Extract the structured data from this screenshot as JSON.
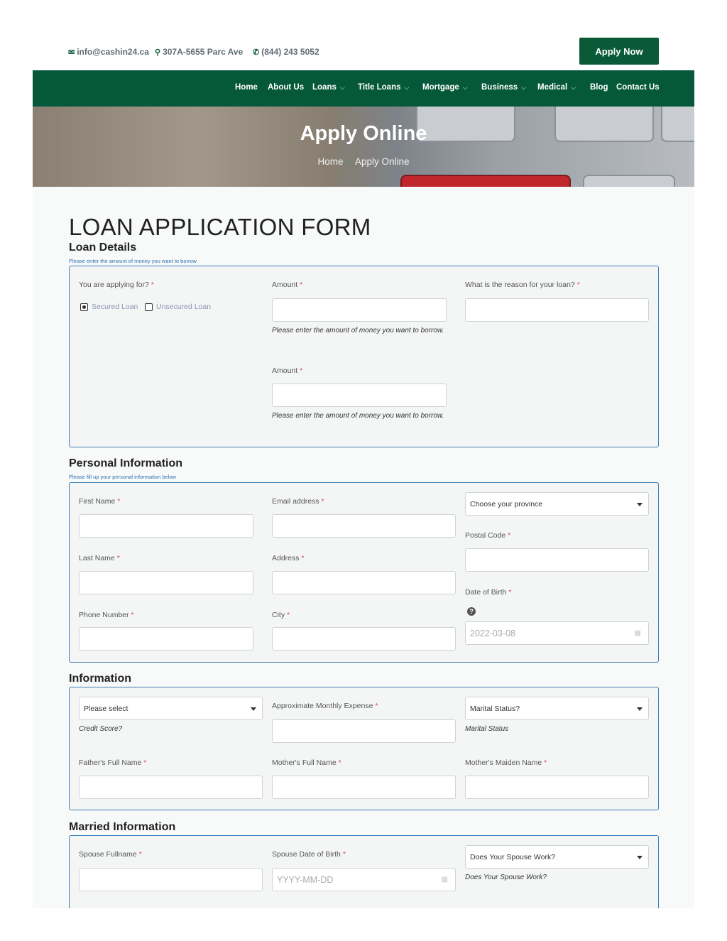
{
  "topbar": {
    "email": "info@cashin24.ca",
    "address": "307A-5655 Parc Ave",
    "phone": "(844) 243 5052",
    "apply_button": "Apply Now"
  },
  "nav": {
    "items": [
      {
        "label": "Home"
      },
      {
        "label": "About Us"
      },
      {
        "label": "Loans"
      },
      {
        "label": "Title Loans"
      },
      {
        "label": "Mortgage"
      },
      {
        "label": "Business"
      },
      {
        "label": "Medical"
      },
      {
        "label": "Blog"
      },
      {
        "label": "Contact Us"
      }
    ],
    "chevron": "⌵"
  },
  "hero": {
    "title": "Apply Online",
    "breadcrumb_home": "Home",
    "breadcrumb_sep": "›",
    "breadcrumb_current": "Apply Online"
  },
  "form": {
    "title": "LOAN APPLICATION FORM",
    "loan": {
      "title": "Loan Details",
      "subtitle": "Please enter the amount of money you want to borrow",
      "applying_label": "You are applying for?",
      "secured": "Secured Loan",
      "unsecured": "Unsecured Loan",
      "amount_label": "Amount",
      "amount_help": "Please enter the amount of money you want to borrow.",
      "amount2_label": "Amount",
      "amount2_help": "Please enter the amount of money you want to borrow.",
      "reason_label": "What is the reason for your loan?"
    },
    "personal": {
      "title": "Personal Information",
      "subtitle": "Please fill up your personal information below",
      "first_name": "First Name",
      "last_name": "Last Name",
      "phone": "Phone Number",
      "email": "Email address",
      "address": "Address",
      "city": "City",
      "province_select": "Choose your province",
      "postal": "Postal Code",
      "dob": "Date of Birth",
      "dob_placeholder": "2022-03-08"
    },
    "info": {
      "title": "Information",
      "credit_select": "Please select",
      "credit_help": "Credit Score?",
      "expense_label": "Approximate Monthly Expense",
      "marital_select": "Marital Status?",
      "marital_help": "Marital Status",
      "father": "Father's Full Name",
      "mother": "Mother's Full Name",
      "maiden": "Mother's Maiden Name"
    },
    "married": {
      "title": "Married Information",
      "spouse_name": "Spouse Fullname",
      "spouse_dob": "Spouse Date of Birth",
      "spouse_dob_placeholder": "YYYY-MM-DD",
      "spouse_work_select": "Does Your Spouse Work?",
      "spouse_work_help": "Does Your Spouse Work?"
    },
    "required_mark": "*"
  }
}
